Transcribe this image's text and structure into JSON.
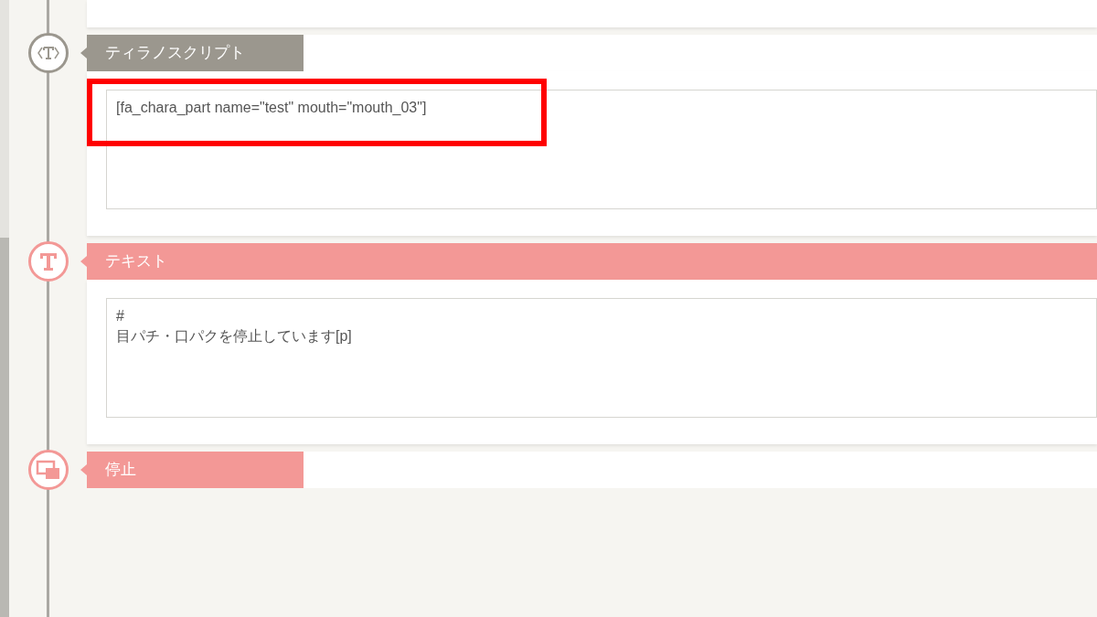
{
  "blocks": [
    {
      "kind": "script",
      "color": "#9b978e",
      "label": "ティラノスクリプト",
      "lines": [
        "[fa_chara_part name=\"test\" mouth=\"mouth_03\"]"
      ],
      "highlighted": true
    },
    {
      "kind": "text",
      "color": "#f39896",
      "label": "テキスト",
      "lines": [
        "#",
        "目パチ・口パクを停止しています[p]"
      ]
    },
    {
      "kind": "stop",
      "color": "#f39896",
      "label": "停止"
    }
  ]
}
